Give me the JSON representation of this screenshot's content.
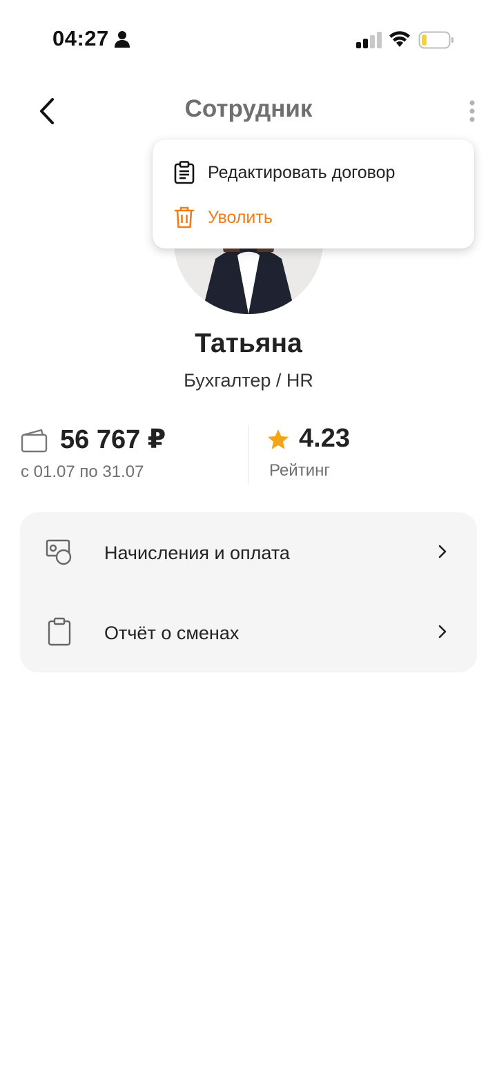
{
  "status_bar": {
    "time": "04:27",
    "icons": [
      "person-icon",
      "cellular-signal-icon",
      "wifi-icon",
      "battery-low-icon"
    ],
    "battery_color": "#f6d32d"
  },
  "header": {
    "title": "Сотрудник",
    "back_icon": "chevron-left-icon",
    "more_icon": "more-vertical-icon"
  },
  "dropdown": {
    "items": [
      {
        "label": "Редактировать договор",
        "icon": "clipboard-text-icon",
        "color": "#222222"
      },
      {
        "label": "Уволить",
        "icon": "trash-icon",
        "color": "#f07d1c"
      }
    ]
  },
  "profile": {
    "name": "Татьяна",
    "role": "Бухгалтер / HR"
  },
  "stats": {
    "salary": {
      "amount": "56 767 ₽",
      "period": "с 01.07 по 31.07",
      "icon": "wallet-icon"
    },
    "rating": {
      "value": "4.23",
      "label": "Рейтинг",
      "icon": "star-icon",
      "icon_color": "#f2a516"
    }
  },
  "menu": {
    "items": [
      {
        "label": "Начисления и оплата",
        "icon": "money-coins-icon"
      },
      {
        "label": "Отчёт о сменах",
        "icon": "clipboard-icon"
      }
    ],
    "chevron_icon": "chevron-right-icon"
  },
  "colors": {
    "accent": "#f07d1c",
    "card_bg": "#f5f5f5",
    "title_gray": "#6f6f6f"
  }
}
